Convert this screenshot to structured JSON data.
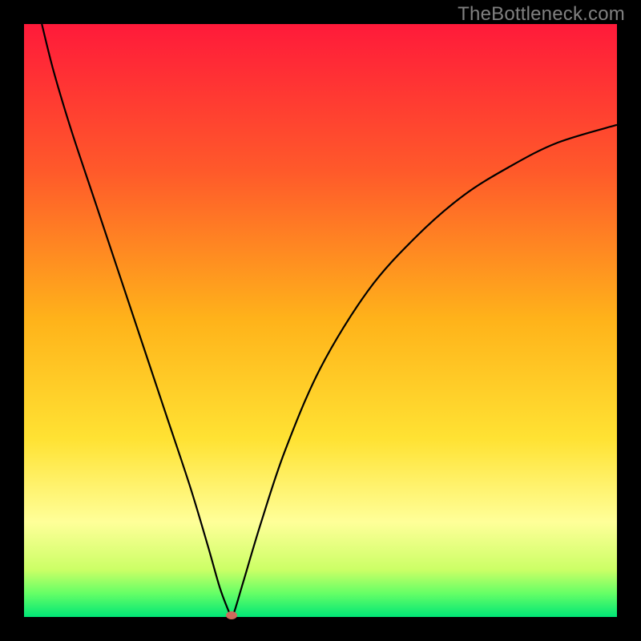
{
  "watermark": "TheBottleneck.com",
  "chart_data": {
    "type": "line",
    "title": "",
    "xlabel": "",
    "ylabel": "",
    "xlim": [
      0,
      100
    ],
    "ylim": [
      0,
      100
    ],
    "minimum_x": 35,
    "colors": {
      "gradient_stops": [
        {
          "offset": 0.0,
          "color": "#ff1a3a"
        },
        {
          "offset": 0.25,
          "color": "#ff5a2a"
        },
        {
          "offset": 0.5,
          "color": "#ffb31a"
        },
        {
          "offset": 0.7,
          "color": "#ffe233"
        },
        {
          "offset": 0.84,
          "color": "#ffff99"
        },
        {
          "offset": 0.92,
          "color": "#ccff66"
        },
        {
          "offset": 0.96,
          "color": "#66ff66"
        },
        {
          "offset": 1.0,
          "color": "#00e676"
        }
      ],
      "curve": "#000000",
      "marker": "#cf6a5c"
    },
    "series": [
      {
        "name": "left-branch",
        "x": [
          3,
          5,
          8,
          12,
          16,
          20,
          24,
          28,
          31,
          33,
          34.5,
          35
        ],
        "y": [
          100,
          92,
          82,
          70,
          58,
          46,
          34,
          22,
          12,
          5,
          1,
          0
        ]
      },
      {
        "name": "right-branch",
        "x": [
          35,
          35.5,
          37,
          40,
          44,
          50,
          58,
          66,
          74,
          82,
          90,
          100
        ],
        "y": [
          0,
          1,
          6,
          16,
          28,
          42,
          55,
          64,
          71,
          76,
          80,
          83
        ]
      }
    ],
    "marker": {
      "x": 35,
      "y": 0
    }
  }
}
